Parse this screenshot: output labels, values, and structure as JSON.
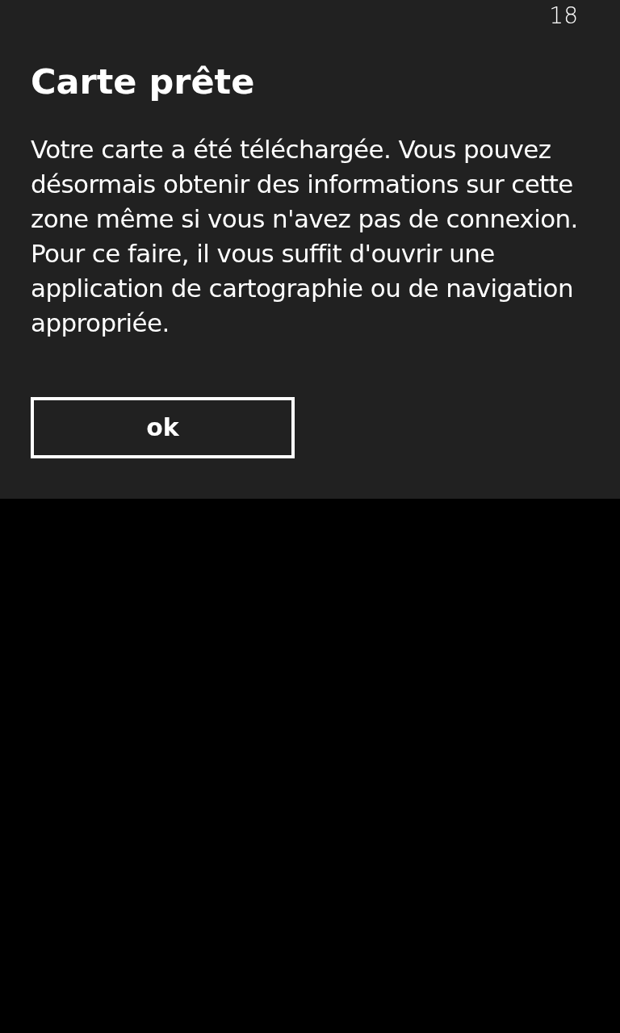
{
  "status_bar": {
    "time": "18"
  },
  "dialog": {
    "title": "Carte prête",
    "message": "Votre carte a été téléchargée. Vous pouvez désormais obtenir des informations sur cette zone même si vous n'avez pas de connexion. Pour ce faire, il vous suffit d'ouvrir une application de cartographie ou de navigation appropriée.",
    "buttons": [
      "ok"
    ]
  }
}
